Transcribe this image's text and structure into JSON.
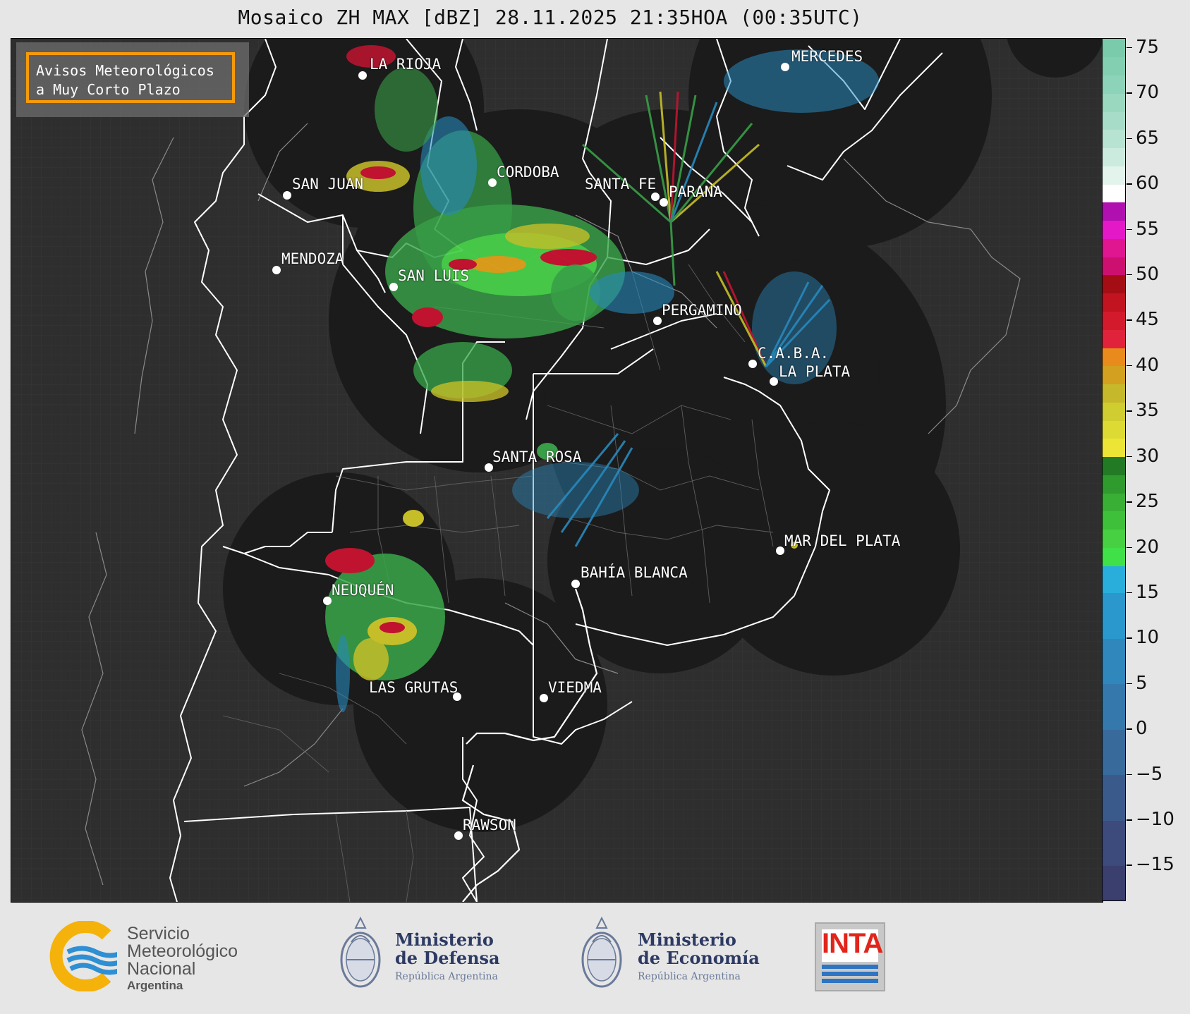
{
  "title": "Mosaico ZH MAX [dBZ] 28.11.2025 21:35HOA (00:35UTC)",
  "legend": {
    "line1": "Avisos Meteorológicos",
    "line2": "a Muy Corto Plazo",
    "warning_color": "#f59a0c"
  },
  "cities": [
    {
      "name": "LA RIOJA"
    },
    {
      "name": "MERCEDES"
    },
    {
      "name": "CORDOBA"
    },
    {
      "name": "SAN JUAN"
    },
    {
      "name": "SANTA FE"
    },
    {
      "name": "PARANA"
    },
    {
      "name": "MENDOZA"
    },
    {
      "name": "SAN LUIS"
    },
    {
      "name": "PERGAMINO"
    },
    {
      "name": "C.A.B.A."
    },
    {
      "name": "LA PLATA"
    },
    {
      "name": "SANTA ROSA"
    },
    {
      "name": "MAR DEL PLATA"
    },
    {
      "name": "BAHÍA BLANCA"
    },
    {
      "name": "NEUQUÉN"
    },
    {
      "name": "LAS GRUTAS"
    },
    {
      "name": "VIEDMA"
    },
    {
      "name": "RAWSON"
    }
  ],
  "colorbar": {
    "unit": "dBZ",
    "min": -19,
    "max": 76,
    "ticks": [
      "75",
      "70",
      "65",
      "60",
      "55",
      "50",
      "45",
      "40",
      "35",
      "30",
      "25",
      "20",
      "15",
      "10",
      "5",
      "0",
      "−5",
      "−10",
      "−15"
    ]
  },
  "logos": {
    "smn": {
      "line1": "Servicio",
      "line2": "Meteorológico",
      "line3": "Nacional",
      "line4": "Argentina"
    },
    "defensa": {
      "line1": "Ministerio",
      "line2": "de Defensa",
      "line3": "República Argentina"
    },
    "economia": {
      "line1": "Ministerio",
      "line2": "de Economía",
      "line3": "República Argentina"
    },
    "inta": {
      "text": "INTA"
    }
  }
}
